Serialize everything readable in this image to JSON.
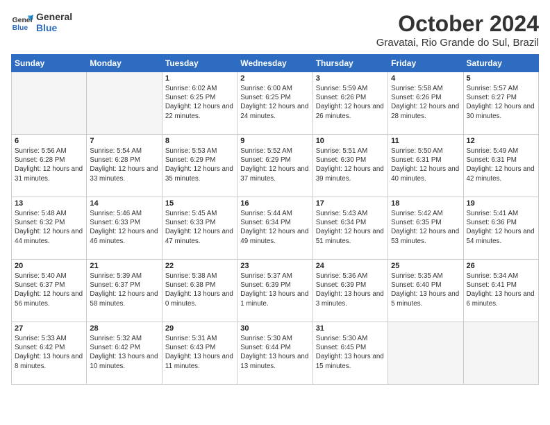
{
  "header": {
    "logo_line1": "General",
    "logo_line2": "Blue",
    "month": "October 2024",
    "location": "Gravatai, Rio Grande do Sul, Brazil"
  },
  "days_of_week": [
    "Sunday",
    "Monday",
    "Tuesday",
    "Wednesday",
    "Thursday",
    "Friday",
    "Saturday"
  ],
  "weeks": [
    [
      {
        "day": "",
        "empty": true
      },
      {
        "day": "",
        "empty": true
      },
      {
        "day": "1",
        "sunrise": "Sunrise: 6:02 AM",
        "sunset": "Sunset: 6:25 PM",
        "daylight": "Daylight: 12 hours and 22 minutes."
      },
      {
        "day": "2",
        "sunrise": "Sunrise: 6:00 AM",
        "sunset": "Sunset: 6:25 PM",
        "daylight": "Daylight: 12 hours and 24 minutes."
      },
      {
        "day": "3",
        "sunrise": "Sunrise: 5:59 AM",
        "sunset": "Sunset: 6:26 PM",
        "daylight": "Daylight: 12 hours and 26 minutes."
      },
      {
        "day": "4",
        "sunrise": "Sunrise: 5:58 AM",
        "sunset": "Sunset: 6:26 PM",
        "daylight": "Daylight: 12 hours and 28 minutes."
      },
      {
        "day": "5",
        "sunrise": "Sunrise: 5:57 AM",
        "sunset": "Sunset: 6:27 PM",
        "daylight": "Daylight: 12 hours and 30 minutes."
      }
    ],
    [
      {
        "day": "6",
        "sunrise": "Sunrise: 5:56 AM",
        "sunset": "Sunset: 6:28 PM",
        "daylight": "Daylight: 12 hours and 31 minutes."
      },
      {
        "day": "7",
        "sunrise": "Sunrise: 5:54 AM",
        "sunset": "Sunset: 6:28 PM",
        "daylight": "Daylight: 12 hours and 33 minutes."
      },
      {
        "day": "8",
        "sunrise": "Sunrise: 5:53 AM",
        "sunset": "Sunset: 6:29 PM",
        "daylight": "Daylight: 12 hours and 35 minutes."
      },
      {
        "day": "9",
        "sunrise": "Sunrise: 5:52 AM",
        "sunset": "Sunset: 6:29 PM",
        "daylight": "Daylight: 12 hours and 37 minutes."
      },
      {
        "day": "10",
        "sunrise": "Sunrise: 5:51 AM",
        "sunset": "Sunset: 6:30 PM",
        "daylight": "Daylight: 12 hours and 39 minutes."
      },
      {
        "day": "11",
        "sunrise": "Sunrise: 5:50 AM",
        "sunset": "Sunset: 6:31 PM",
        "daylight": "Daylight: 12 hours and 40 minutes."
      },
      {
        "day": "12",
        "sunrise": "Sunrise: 5:49 AM",
        "sunset": "Sunset: 6:31 PM",
        "daylight": "Daylight: 12 hours and 42 minutes."
      }
    ],
    [
      {
        "day": "13",
        "sunrise": "Sunrise: 5:48 AM",
        "sunset": "Sunset: 6:32 PM",
        "daylight": "Daylight: 12 hours and 44 minutes."
      },
      {
        "day": "14",
        "sunrise": "Sunrise: 5:46 AM",
        "sunset": "Sunset: 6:33 PM",
        "daylight": "Daylight: 12 hours and 46 minutes."
      },
      {
        "day": "15",
        "sunrise": "Sunrise: 5:45 AM",
        "sunset": "Sunset: 6:33 PM",
        "daylight": "Daylight: 12 hours and 47 minutes."
      },
      {
        "day": "16",
        "sunrise": "Sunrise: 5:44 AM",
        "sunset": "Sunset: 6:34 PM",
        "daylight": "Daylight: 12 hours and 49 minutes."
      },
      {
        "day": "17",
        "sunrise": "Sunrise: 5:43 AM",
        "sunset": "Sunset: 6:34 PM",
        "daylight": "Daylight: 12 hours and 51 minutes."
      },
      {
        "day": "18",
        "sunrise": "Sunrise: 5:42 AM",
        "sunset": "Sunset: 6:35 PM",
        "daylight": "Daylight: 12 hours and 53 minutes."
      },
      {
        "day": "19",
        "sunrise": "Sunrise: 5:41 AM",
        "sunset": "Sunset: 6:36 PM",
        "daylight": "Daylight: 12 hours and 54 minutes."
      }
    ],
    [
      {
        "day": "20",
        "sunrise": "Sunrise: 5:40 AM",
        "sunset": "Sunset: 6:37 PM",
        "daylight": "Daylight: 12 hours and 56 minutes."
      },
      {
        "day": "21",
        "sunrise": "Sunrise: 5:39 AM",
        "sunset": "Sunset: 6:37 PM",
        "daylight": "Daylight: 12 hours and 58 minutes."
      },
      {
        "day": "22",
        "sunrise": "Sunrise: 5:38 AM",
        "sunset": "Sunset: 6:38 PM",
        "daylight": "Daylight: 13 hours and 0 minutes."
      },
      {
        "day": "23",
        "sunrise": "Sunrise: 5:37 AM",
        "sunset": "Sunset: 6:39 PM",
        "daylight": "Daylight: 13 hours and 1 minute."
      },
      {
        "day": "24",
        "sunrise": "Sunrise: 5:36 AM",
        "sunset": "Sunset: 6:39 PM",
        "daylight": "Daylight: 13 hours and 3 minutes."
      },
      {
        "day": "25",
        "sunrise": "Sunrise: 5:35 AM",
        "sunset": "Sunset: 6:40 PM",
        "daylight": "Daylight: 13 hours and 5 minutes."
      },
      {
        "day": "26",
        "sunrise": "Sunrise: 5:34 AM",
        "sunset": "Sunset: 6:41 PM",
        "daylight": "Daylight: 13 hours and 6 minutes."
      }
    ],
    [
      {
        "day": "27",
        "sunrise": "Sunrise: 5:33 AM",
        "sunset": "Sunset: 6:42 PM",
        "daylight": "Daylight: 13 hours and 8 minutes."
      },
      {
        "day": "28",
        "sunrise": "Sunrise: 5:32 AM",
        "sunset": "Sunset: 6:42 PM",
        "daylight": "Daylight: 13 hours and 10 minutes."
      },
      {
        "day": "29",
        "sunrise": "Sunrise: 5:31 AM",
        "sunset": "Sunset: 6:43 PM",
        "daylight": "Daylight: 13 hours and 11 minutes."
      },
      {
        "day": "30",
        "sunrise": "Sunrise: 5:30 AM",
        "sunset": "Sunset: 6:44 PM",
        "daylight": "Daylight: 13 hours and 13 minutes."
      },
      {
        "day": "31",
        "sunrise": "Sunrise: 5:30 AM",
        "sunset": "Sunset: 6:45 PM",
        "daylight": "Daylight: 13 hours and 15 minutes."
      },
      {
        "day": "",
        "empty": true
      },
      {
        "day": "",
        "empty": true
      }
    ]
  ]
}
